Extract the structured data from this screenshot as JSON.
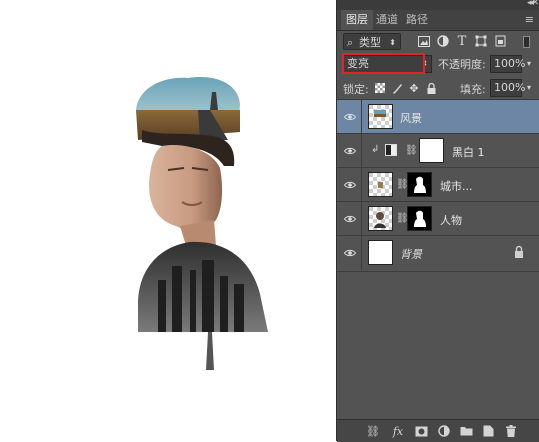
{
  "panel": {
    "tabs": [
      "图层",
      "通道",
      "路径"
    ],
    "filter": {
      "search_glyph": "⌕",
      "label": "类型"
    },
    "blend": {
      "mode": "变亮",
      "opacity_label": "不透明度:",
      "opacity_value": "100%"
    },
    "lock": {
      "label": "锁定:",
      "fill_label": "填充:",
      "fill_value": "100%"
    },
    "layers": [
      {
        "name": "风景",
        "selected": true,
        "type": "pixel"
      },
      {
        "name": "黑白 1",
        "selected": false,
        "type": "adjustment"
      },
      {
        "name": "城市...",
        "selected": false,
        "type": "masked"
      },
      {
        "name": "人物",
        "selected": false,
        "type": "masked"
      },
      {
        "name": "背景",
        "selected": false,
        "type": "background",
        "locked": true
      }
    ]
  },
  "colors": {
    "panel_bg": "#535353",
    "selected_row": "#6d86a4",
    "highlight_box": "#e2242a"
  }
}
